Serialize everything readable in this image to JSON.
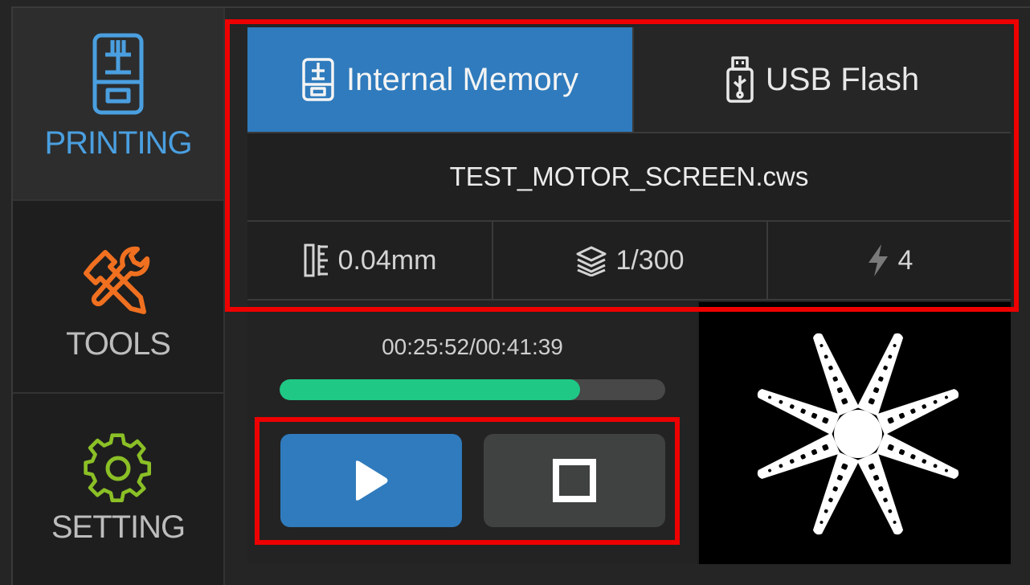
{
  "sidebar": {
    "items": [
      {
        "label": "PRINTING",
        "icon": "printer-icon",
        "active": true
      },
      {
        "label": "TOOLS",
        "icon": "wrench-screwdriver-icon",
        "active": false
      },
      {
        "label": "SETTING",
        "icon": "gear-icon",
        "active": false
      }
    ]
  },
  "tabs": [
    {
      "label": "Internal Memory",
      "icon": "printer-small-icon",
      "active": true
    },
    {
      "label": "USB Flash",
      "icon": "usb-icon",
      "active": false
    }
  ],
  "file": {
    "name": "TEST_MOTOR_SCREEN.cws"
  },
  "stats": {
    "layer_height": "0.04mm",
    "layers": "1/300",
    "exposure": "4"
  },
  "job": {
    "time": "00:25:52/00:41:39",
    "progress": 0.78
  },
  "controls": {
    "play_icon": "play-icon",
    "stop_icon": "stop-icon"
  },
  "colors": {
    "accent_blue": "#2f7bbd",
    "progress_green": "#1fc885",
    "tools_orange": "#f07020",
    "setting_green": "#8bc026",
    "highlight_red": "#ee0000"
  }
}
